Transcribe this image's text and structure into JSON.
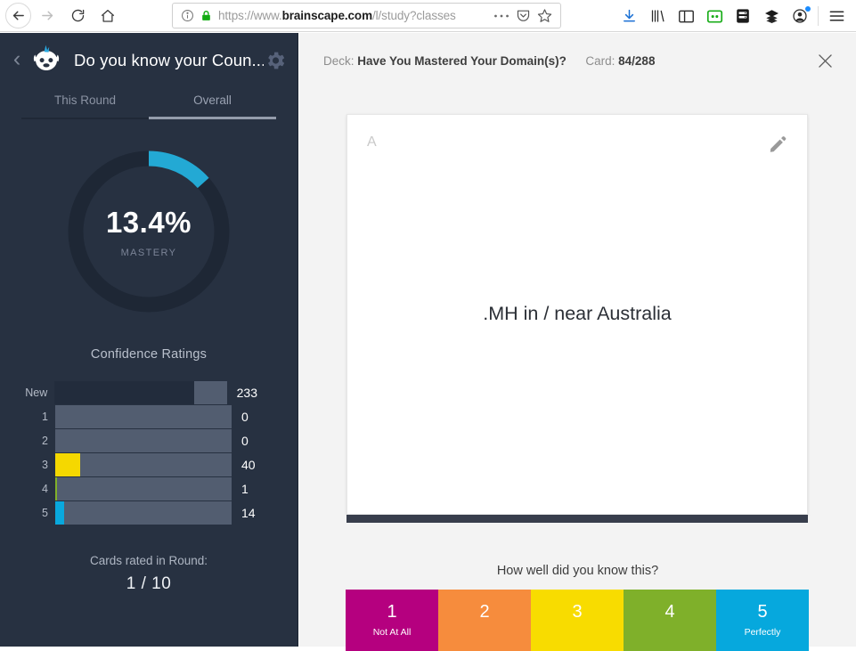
{
  "browser": {
    "back_icon": "back-arrow-icon",
    "forward_icon": "forward-arrow-icon",
    "reload_icon": "reload-icon",
    "home_icon": "home-icon",
    "url_scheme": "https://www.",
    "url_domain": "brainscape.com",
    "url_path": "/l/study?classes",
    "info_icon": "page-info-icon",
    "lock_icon": "padlock-icon",
    "page_actions_icon": "ellipsis-icon",
    "pocket_icon": "pocket-icon",
    "bookmark_icon": "star-icon",
    "toolbar_icons": [
      "download-icon",
      "library-icon",
      "sidebar-icon",
      "robot-extension-icon",
      "server-extension-icon",
      "layers-extension-icon",
      "account-icon",
      "menu-icon"
    ]
  },
  "sidebar": {
    "back_chevron": "‹",
    "logo_icon": "brainscape-logo-icon",
    "title": "Do you know your Coun...",
    "gear_icon": "gear-icon",
    "tabs": [
      {
        "label": "This Round",
        "active": false
      },
      {
        "label": "Overall",
        "active": true
      }
    ],
    "mastery": {
      "percent_label": "13.4%",
      "percent_value": 13.4,
      "caption": "MASTERY",
      "arc_color": "#23a9d4",
      "track_color": "#1e2735"
    },
    "confidence": {
      "title": "Confidence Ratings",
      "rows": [
        {
          "label": "New",
          "value": "233",
          "count": 233,
          "fill_pct": 81,
          "color": "#222c3c"
        },
        {
          "label": "1",
          "value": "0",
          "count": 0,
          "fill_pct": 0,
          "color": "#b5007f"
        },
        {
          "label": "2",
          "value": "0",
          "count": 0,
          "fill_pct": 0,
          "color": "#f58a3c"
        },
        {
          "label": "3",
          "value": "40",
          "count": 40,
          "fill_pct": 14,
          "color": "#f5d800"
        },
        {
          "label": "4",
          "value": "1",
          "count": 1,
          "fill_pct": 0.8,
          "color": "#80b029"
        },
        {
          "label": "5",
          "value": "14",
          "count": 14,
          "fill_pct": 5,
          "color": "#09a8dd"
        }
      ]
    },
    "cards_rated": {
      "caption": "Cards rated in Round:",
      "count": "1 / 10"
    }
  },
  "main": {
    "deck_prefix": "Deck:",
    "deck_name": "Have You Mastered Your Domain(s)?",
    "card_prefix": "Card:",
    "card_position": "84/288",
    "close_icon": "close-icon",
    "card": {
      "side_label": "A",
      "edit_icon": "pencil-icon",
      "text": ".MH in / near Australia"
    },
    "prompt": "How well did you know this?",
    "ratings": [
      {
        "number": "1",
        "caption": "Not At All",
        "color": "#b5007f"
      },
      {
        "number": "2",
        "caption": "",
        "color": "#f68c3d"
      },
      {
        "number": "3",
        "caption": "",
        "color": "#f8dc00"
      },
      {
        "number": "4",
        "caption": "",
        "color": "#7fb02a"
      },
      {
        "number": "5",
        "caption": "Perfectly",
        "color": "#06a8dd"
      }
    ]
  }
}
